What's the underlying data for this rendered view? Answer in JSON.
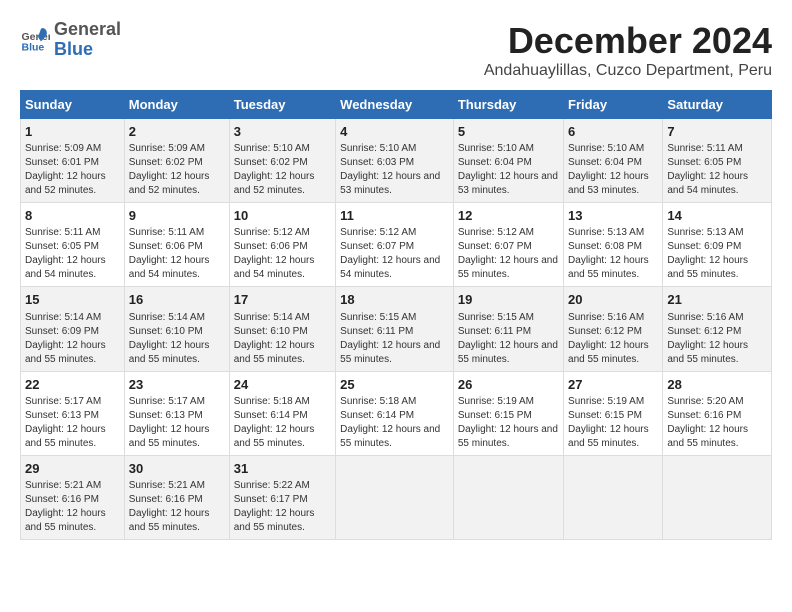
{
  "header": {
    "logo_line1": "General",
    "logo_line2": "Blue",
    "month": "December 2024",
    "location": "Andahuaylillas, Cuzco Department, Peru"
  },
  "weekdays": [
    "Sunday",
    "Monday",
    "Tuesday",
    "Wednesday",
    "Thursday",
    "Friday",
    "Saturday"
  ],
  "weeks": [
    [
      {
        "day": "1",
        "content": "Sunrise: 5:09 AM\nSunset: 6:01 PM\nDaylight: 12 hours and 52 minutes."
      },
      {
        "day": "2",
        "content": "Sunrise: 5:09 AM\nSunset: 6:02 PM\nDaylight: 12 hours and 52 minutes."
      },
      {
        "day": "3",
        "content": "Sunrise: 5:10 AM\nSunset: 6:02 PM\nDaylight: 12 hours and 52 minutes."
      },
      {
        "day": "4",
        "content": "Sunrise: 5:10 AM\nSunset: 6:03 PM\nDaylight: 12 hours and 53 minutes."
      },
      {
        "day": "5",
        "content": "Sunrise: 5:10 AM\nSunset: 6:04 PM\nDaylight: 12 hours and 53 minutes."
      },
      {
        "day": "6",
        "content": "Sunrise: 5:10 AM\nSunset: 6:04 PM\nDaylight: 12 hours and 53 minutes."
      },
      {
        "day": "7",
        "content": "Sunrise: 5:11 AM\nSunset: 6:05 PM\nDaylight: 12 hours and 54 minutes."
      }
    ],
    [
      {
        "day": "8",
        "content": "Sunrise: 5:11 AM\nSunset: 6:05 PM\nDaylight: 12 hours and 54 minutes."
      },
      {
        "day": "9",
        "content": "Sunrise: 5:11 AM\nSunset: 6:06 PM\nDaylight: 12 hours and 54 minutes."
      },
      {
        "day": "10",
        "content": "Sunrise: 5:12 AM\nSunset: 6:06 PM\nDaylight: 12 hours and 54 minutes."
      },
      {
        "day": "11",
        "content": "Sunrise: 5:12 AM\nSunset: 6:07 PM\nDaylight: 12 hours and 54 minutes."
      },
      {
        "day": "12",
        "content": "Sunrise: 5:12 AM\nSunset: 6:07 PM\nDaylight: 12 hours and 55 minutes."
      },
      {
        "day": "13",
        "content": "Sunrise: 5:13 AM\nSunset: 6:08 PM\nDaylight: 12 hours and 55 minutes."
      },
      {
        "day": "14",
        "content": "Sunrise: 5:13 AM\nSunset: 6:09 PM\nDaylight: 12 hours and 55 minutes."
      }
    ],
    [
      {
        "day": "15",
        "content": "Sunrise: 5:14 AM\nSunset: 6:09 PM\nDaylight: 12 hours and 55 minutes."
      },
      {
        "day": "16",
        "content": "Sunrise: 5:14 AM\nSunset: 6:10 PM\nDaylight: 12 hours and 55 minutes."
      },
      {
        "day": "17",
        "content": "Sunrise: 5:14 AM\nSunset: 6:10 PM\nDaylight: 12 hours and 55 minutes."
      },
      {
        "day": "18",
        "content": "Sunrise: 5:15 AM\nSunset: 6:11 PM\nDaylight: 12 hours and 55 minutes."
      },
      {
        "day": "19",
        "content": "Sunrise: 5:15 AM\nSunset: 6:11 PM\nDaylight: 12 hours and 55 minutes."
      },
      {
        "day": "20",
        "content": "Sunrise: 5:16 AM\nSunset: 6:12 PM\nDaylight: 12 hours and 55 minutes."
      },
      {
        "day": "21",
        "content": "Sunrise: 5:16 AM\nSunset: 6:12 PM\nDaylight: 12 hours and 55 minutes."
      }
    ],
    [
      {
        "day": "22",
        "content": "Sunrise: 5:17 AM\nSunset: 6:13 PM\nDaylight: 12 hours and 55 minutes."
      },
      {
        "day": "23",
        "content": "Sunrise: 5:17 AM\nSunset: 6:13 PM\nDaylight: 12 hours and 55 minutes."
      },
      {
        "day": "24",
        "content": "Sunrise: 5:18 AM\nSunset: 6:14 PM\nDaylight: 12 hours and 55 minutes."
      },
      {
        "day": "25",
        "content": "Sunrise: 5:18 AM\nSunset: 6:14 PM\nDaylight: 12 hours and 55 minutes."
      },
      {
        "day": "26",
        "content": "Sunrise: 5:19 AM\nSunset: 6:15 PM\nDaylight: 12 hours and 55 minutes."
      },
      {
        "day": "27",
        "content": "Sunrise: 5:19 AM\nSunset: 6:15 PM\nDaylight: 12 hours and 55 minutes."
      },
      {
        "day": "28",
        "content": "Sunrise: 5:20 AM\nSunset: 6:16 PM\nDaylight: 12 hours and 55 minutes."
      }
    ],
    [
      {
        "day": "29",
        "content": "Sunrise: 5:21 AM\nSunset: 6:16 PM\nDaylight: 12 hours and 55 minutes."
      },
      {
        "day": "30",
        "content": "Sunrise: 5:21 AM\nSunset: 6:16 PM\nDaylight: 12 hours and 55 minutes."
      },
      {
        "day": "31",
        "content": "Sunrise: 5:22 AM\nSunset: 6:17 PM\nDaylight: 12 hours and 55 minutes."
      },
      {
        "day": "",
        "content": ""
      },
      {
        "day": "",
        "content": ""
      },
      {
        "day": "",
        "content": ""
      },
      {
        "day": "",
        "content": ""
      }
    ]
  ]
}
